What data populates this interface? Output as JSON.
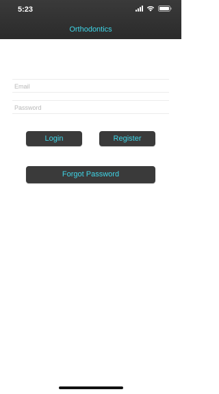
{
  "status_bar": {
    "time": "5:23",
    "icons": [
      "signal-icon",
      "wifi-icon",
      "battery-icon"
    ]
  },
  "nav": {
    "title": "Orthodontics"
  },
  "form": {
    "email_placeholder": "Email",
    "email_value": "",
    "password_placeholder": "Password",
    "password_value": ""
  },
  "buttons": {
    "login_label": "Login",
    "register_label": "Register",
    "forgot_password_label": "Forgot Password"
  },
  "colors": {
    "header_bg": "#2f2f2f",
    "accent": "#3fd6e8",
    "button_bg": "#3a3a3a"
  }
}
